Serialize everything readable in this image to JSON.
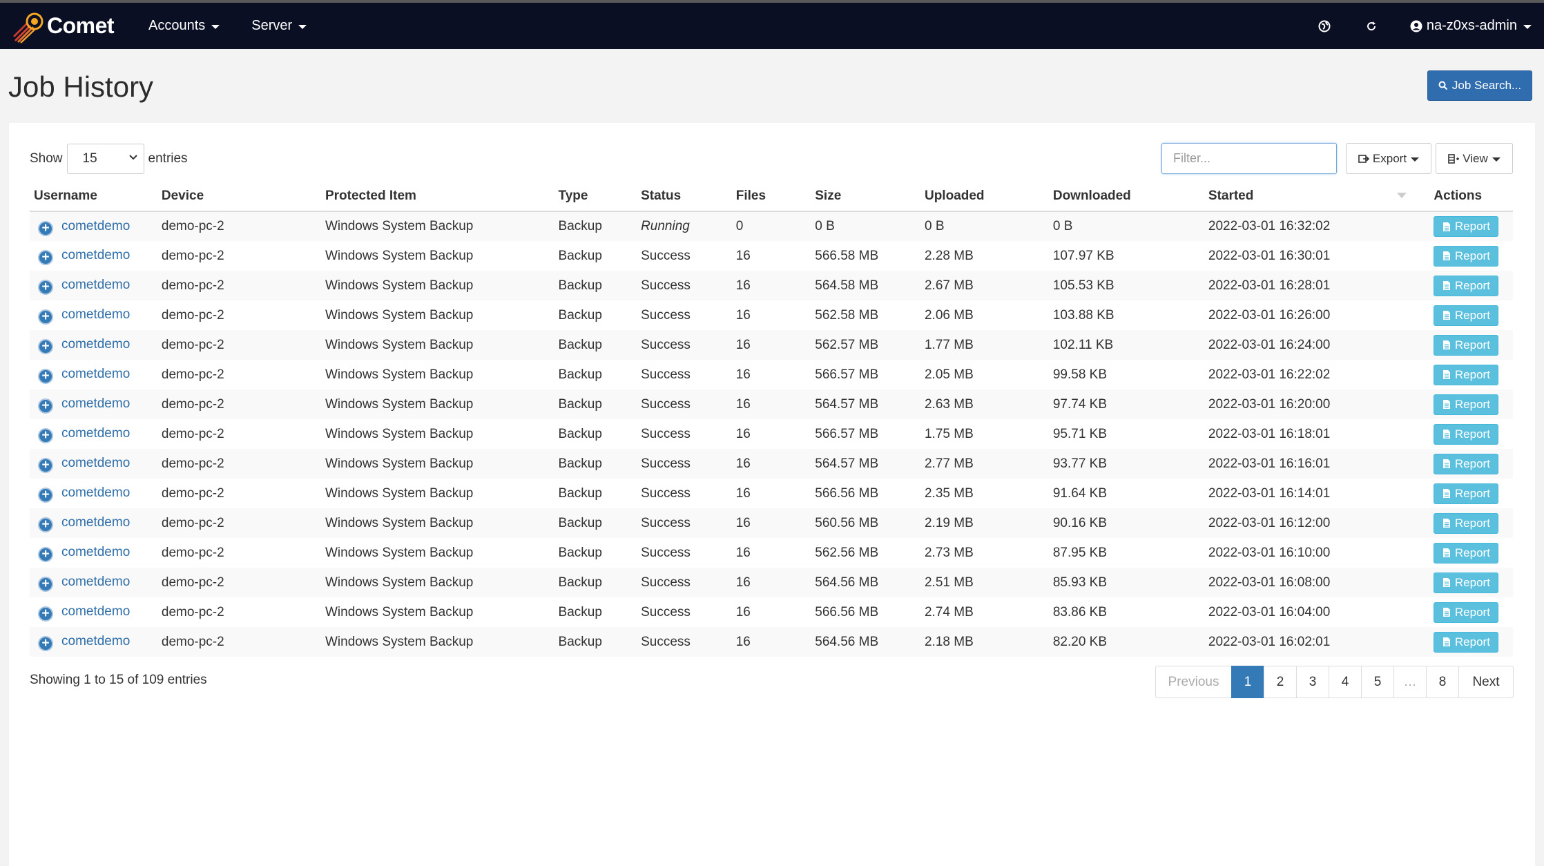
{
  "navbar": {
    "brand": "Comet",
    "menu": [
      {
        "label": "Accounts"
      },
      {
        "label": "Server"
      }
    ],
    "user": "na-z0xs-admin"
  },
  "page": {
    "title": "Job History",
    "job_search_label": "Job Search..."
  },
  "controls": {
    "show_label": "Show",
    "entries_label": "entries",
    "page_length": "15",
    "filter_placeholder": "Filter...",
    "export_label": "Export",
    "view_label": "View"
  },
  "table": {
    "columns": [
      "Username",
      "Device",
      "Protected Item",
      "Type",
      "Status",
      "Files",
      "Size",
      "Uploaded",
      "Downloaded",
      "Started",
      "Actions"
    ],
    "action_label": "Report",
    "rows": [
      {
        "username": "cometdemo",
        "device": "demo-pc-2",
        "item": "Windows System Backup",
        "type": "Backup",
        "status": "Running",
        "files": "0",
        "size": "0 B",
        "uploaded": "0 B",
        "downloaded": "0 B",
        "started": "2022-03-01 16:32:02"
      },
      {
        "username": "cometdemo",
        "device": "demo-pc-2",
        "item": "Windows System Backup",
        "type": "Backup",
        "status": "Success",
        "files": "16",
        "size": "566.58 MB",
        "uploaded": "2.28 MB",
        "downloaded": "107.97 KB",
        "started": "2022-03-01 16:30:01"
      },
      {
        "username": "cometdemo",
        "device": "demo-pc-2",
        "item": "Windows System Backup",
        "type": "Backup",
        "status": "Success",
        "files": "16",
        "size": "564.58 MB",
        "uploaded": "2.67 MB",
        "downloaded": "105.53 KB",
        "started": "2022-03-01 16:28:01"
      },
      {
        "username": "cometdemo",
        "device": "demo-pc-2",
        "item": "Windows System Backup",
        "type": "Backup",
        "status": "Success",
        "files": "16",
        "size": "562.58 MB",
        "uploaded": "2.06 MB",
        "downloaded": "103.88 KB",
        "started": "2022-03-01 16:26:00"
      },
      {
        "username": "cometdemo",
        "device": "demo-pc-2",
        "item": "Windows System Backup",
        "type": "Backup",
        "status": "Success",
        "files": "16",
        "size": "562.57 MB",
        "uploaded": "1.77 MB",
        "downloaded": "102.11 KB",
        "started": "2022-03-01 16:24:00"
      },
      {
        "username": "cometdemo",
        "device": "demo-pc-2",
        "item": "Windows System Backup",
        "type": "Backup",
        "status": "Success",
        "files": "16",
        "size": "566.57 MB",
        "uploaded": "2.05 MB",
        "downloaded": "99.58 KB",
        "started": "2022-03-01 16:22:02"
      },
      {
        "username": "cometdemo",
        "device": "demo-pc-2",
        "item": "Windows System Backup",
        "type": "Backup",
        "status": "Success",
        "files": "16",
        "size": "564.57 MB",
        "uploaded": "2.63 MB",
        "downloaded": "97.74 KB",
        "started": "2022-03-01 16:20:00"
      },
      {
        "username": "cometdemo",
        "device": "demo-pc-2",
        "item": "Windows System Backup",
        "type": "Backup",
        "status": "Success",
        "files": "16",
        "size": "566.57 MB",
        "uploaded": "1.75 MB",
        "downloaded": "95.71 KB",
        "started": "2022-03-01 16:18:01"
      },
      {
        "username": "cometdemo",
        "device": "demo-pc-2",
        "item": "Windows System Backup",
        "type": "Backup",
        "status": "Success",
        "files": "16",
        "size": "564.57 MB",
        "uploaded": "2.77 MB",
        "downloaded": "93.77 KB",
        "started": "2022-03-01 16:16:01"
      },
      {
        "username": "cometdemo",
        "device": "demo-pc-2",
        "item": "Windows System Backup",
        "type": "Backup",
        "status": "Success",
        "files": "16",
        "size": "566.56 MB",
        "uploaded": "2.35 MB",
        "downloaded": "91.64 KB",
        "started": "2022-03-01 16:14:01"
      },
      {
        "username": "cometdemo",
        "device": "demo-pc-2",
        "item": "Windows System Backup",
        "type": "Backup",
        "status": "Success",
        "files": "16",
        "size": "560.56 MB",
        "uploaded": "2.19 MB",
        "downloaded": "90.16 KB",
        "started": "2022-03-01 16:12:00"
      },
      {
        "username": "cometdemo",
        "device": "demo-pc-2",
        "item": "Windows System Backup",
        "type": "Backup",
        "status": "Success",
        "files": "16",
        "size": "562.56 MB",
        "uploaded": "2.73 MB",
        "downloaded": "87.95 KB",
        "started": "2022-03-01 16:10:00"
      },
      {
        "username": "cometdemo",
        "device": "demo-pc-2",
        "item": "Windows System Backup",
        "type": "Backup",
        "status": "Success",
        "files": "16",
        "size": "564.56 MB",
        "uploaded": "2.51 MB",
        "downloaded": "85.93 KB",
        "started": "2022-03-01 16:08:00"
      },
      {
        "username": "cometdemo",
        "device": "demo-pc-2",
        "item": "Windows System Backup",
        "type": "Backup",
        "status": "Success",
        "files": "16",
        "size": "566.56 MB",
        "uploaded": "2.74 MB",
        "downloaded": "83.86 KB",
        "started": "2022-03-01 16:04:00"
      },
      {
        "username": "cometdemo",
        "device": "demo-pc-2",
        "item": "Windows System Backup",
        "type": "Backup",
        "status": "Success",
        "files": "16",
        "size": "564.56 MB",
        "uploaded": "2.18 MB",
        "downloaded": "82.20 KB",
        "started": "2022-03-01 16:02:01"
      }
    ]
  },
  "footer": {
    "info": "Showing 1 to 15 of 109 entries",
    "pagination": {
      "previous": "Previous",
      "pages": [
        "1",
        "2",
        "3",
        "4",
        "5"
      ],
      "ellipsis": "…",
      "last": "8",
      "next": "Next",
      "current": "1"
    }
  },
  "colors": {
    "navbar_bg": "#0b0f24",
    "primary": "#337ab7",
    "info": "#5bc0de",
    "success_text": "#2d7a2d"
  },
  "icons": {
    "brand": "comet-logo-icon",
    "globe": "globe-icon",
    "refresh": "refresh-icon",
    "user": "user-circle-icon",
    "search": "search-icon",
    "export": "export-icon",
    "view": "columns-icon",
    "expand": "plus-circle-icon",
    "report": "file-icon"
  }
}
